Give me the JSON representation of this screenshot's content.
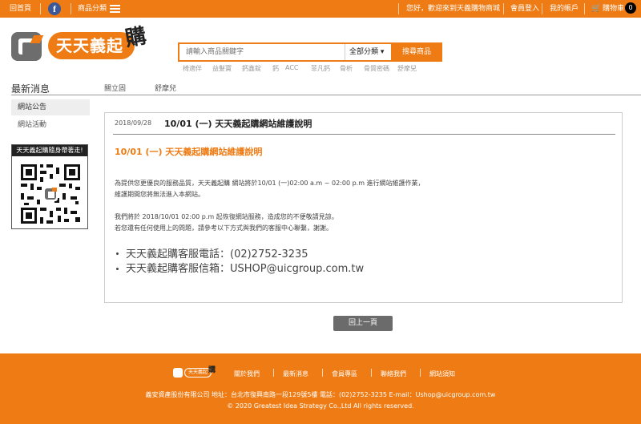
{
  "topbar": {
    "home": "回首頁",
    "facebook_letter": "f",
    "category": "商品分類",
    "welcome": "您好，歡迎來到天義購物商城",
    "login": "會員登入",
    "account": "我的帳戶",
    "cart": "購物車",
    "cart_count": "0"
  },
  "logo": {
    "text": "天天義起",
    "char": "購"
  },
  "search": {
    "placeholder": "請輸入商品關鍵字",
    "category_value": "全部分類 ▾",
    "button": "搜尋商品",
    "hot_keywords": [
      "椅適伴",
      "益髮寶",
      "鈣鑫錠",
      "鈣",
      "ACC",
      "菲凡鈣",
      "骨析",
      "骨質密碼",
      "舒摩兒"
    ]
  },
  "section": {
    "title": "最新消息",
    "tabs": [
      "關立固",
      "舒摩兒"
    ]
  },
  "sidebar": {
    "items": [
      "網站公告",
      "網站活動"
    ],
    "qr_title": "天天義起購隨身帶著走!"
  },
  "article": {
    "date": "2018/09/28",
    "headline": "10/01 (一) 天天義起購網站維護說明",
    "title": "10/01 (一) 天天義起購網站維護說明",
    "p1": "為提供您更優良的服務品質，天天義起購 網站將於10/01 (一)02:00 a.m ~ 02:00 p.m 進行網站維護作業，",
    "p2": "維護期間您將無法進入本網站。",
    "p3": "我們將於 2018/10/01  02:00 p.m 起恢復網站服務，造成您的不便敬請見諒。",
    "p4": "若您還有任何使用上的問題，請參考以下方式與我們的客服中心聯繫，謝謝。",
    "phone": "天天義起購客服電話：(02)2752-3235",
    "email": "天天義起購客服信箱：USHOP@uicgroup.com.tw"
  },
  "back_button": "回上一頁",
  "footer": {
    "logo_text": "天天義起",
    "logo_char": "購",
    "links": [
      "關於我們",
      "最新消息",
      "會員專區",
      "聯絡我們",
      "網站須知"
    ],
    "info": "義安資產股份有限公司  地址：台北市復興南路一段129號5樓  電話：(02)2752-3235  E-mail：Ushop@uicgroup.com.tw",
    "copyright": "© 2020 Greatest Idea Strategy Co.,Ltd All rights reserved."
  },
  "colors": {
    "brand": "#ee7b13",
    "button_gray": "#6b6b6b"
  }
}
